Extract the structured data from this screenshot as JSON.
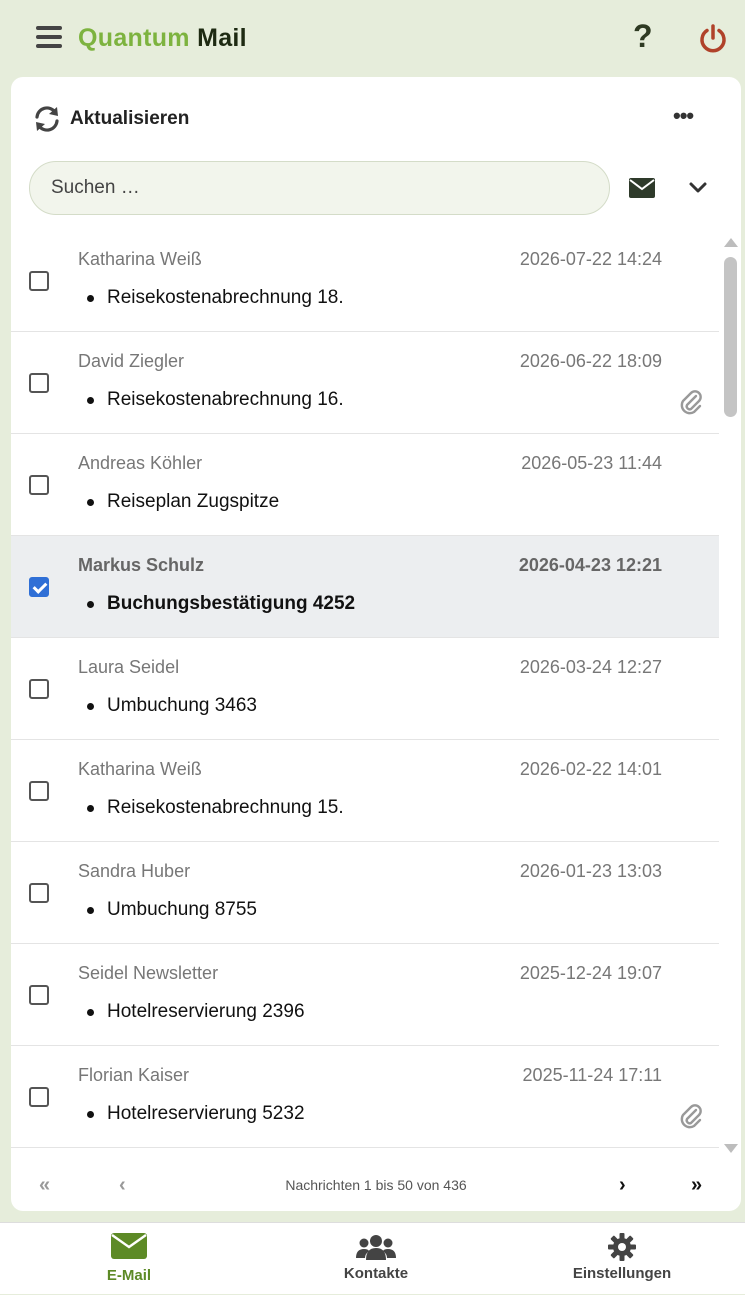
{
  "app": {
    "brand_part1": "Quantum",
    "brand_part2": "Mail"
  },
  "header": {
    "help_label": "?"
  },
  "toolbar": {
    "refresh_label": "Aktualisieren",
    "more_label": "•••"
  },
  "search": {
    "placeholder": "Suchen …"
  },
  "colors": {
    "accent": "#7db33f",
    "selected_row": "#eceef0",
    "checkbox_checked": "#2f6fd6",
    "power": "#b0422a"
  },
  "messages": [
    {
      "sender": "Katharina Weiß",
      "date": "2026-07-22 14:24",
      "subject": "Reisekostenabrechnung 18.",
      "attachment": false,
      "selected": false
    },
    {
      "sender": "David Ziegler",
      "date": "2026-06-22 18:09",
      "subject": "Reisekostenabrechnung 16.",
      "attachment": true,
      "selected": false
    },
    {
      "sender": "Andreas Köhler",
      "date": "2026-05-23 11:44",
      "subject": "Reiseplan Zugspitze",
      "attachment": false,
      "selected": false
    },
    {
      "sender": "Markus Schulz",
      "date": "2026-04-23 12:21",
      "subject": "Buchungsbestätigung 4252",
      "attachment": false,
      "selected": true
    },
    {
      "sender": "Laura Seidel",
      "date": "2026-03-24 12:27",
      "subject": "Umbuchung 3463",
      "attachment": false,
      "selected": false
    },
    {
      "sender": "Katharina Weiß",
      "date": "2026-02-22 14:01",
      "subject": "Reisekostenabrechnung 15.",
      "attachment": false,
      "selected": false
    },
    {
      "sender": "Sandra Huber",
      "date": "2026-01-23 13:03",
      "subject": "Umbuchung 8755",
      "attachment": false,
      "selected": false
    },
    {
      "sender": "Seidel Newsletter",
      "date": "2025-12-24 19:07",
      "subject": "Hotelreservierung 2396",
      "attachment": false,
      "selected": false
    },
    {
      "sender": "Florian Kaiser",
      "date": "2025-11-24 17:11",
      "subject": "Hotelreservierung 5232",
      "attachment": true,
      "selected": false
    }
  ],
  "pager": {
    "first": "«",
    "prev": "‹",
    "info": "Nachrichten 1 bis 50 von 436",
    "next": "›",
    "last": "»"
  },
  "nav": [
    {
      "label": "E-Mail",
      "icon": "envelope-icon",
      "active": true
    },
    {
      "label": "Kontakte",
      "icon": "users-icon",
      "active": false
    },
    {
      "label": "Einstellungen",
      "icon": "gear-icon",
      "active": false
    }
  ]
}
